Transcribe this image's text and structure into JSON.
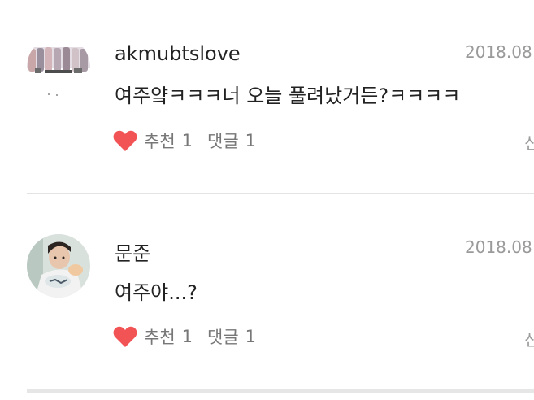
{
  "comments": [
    {
      "username": "akmubtslove",
      "date": "2018.08",
      "text": "여주얔ㅋㅋㅋ너 오늘 풀려났거든?ㅋㅋㅋㅋ",
      "like_label": "추천",
      "like_count": "1",
      "reply_label": "댓글",
      "reply_count": "1",
      "more_label": "신"
    },
    {
      "username": "문준",
      "date": "2018.08",
      "text": "여주야...?",
      "like_label": "추천",
      "like_count": "1",
      "reply_label": "댓글",
      "reply_count": "1",
      "more_label": "신"
    }
  ],
  "colors": {
    "heart": "#f25355",
    "secondary_text": "#777777",
    "primary_text": "#222222",
    "divider": "#e3e3e3"
  },
  "icons": {
    "like": "heart-icon"
  }
}
